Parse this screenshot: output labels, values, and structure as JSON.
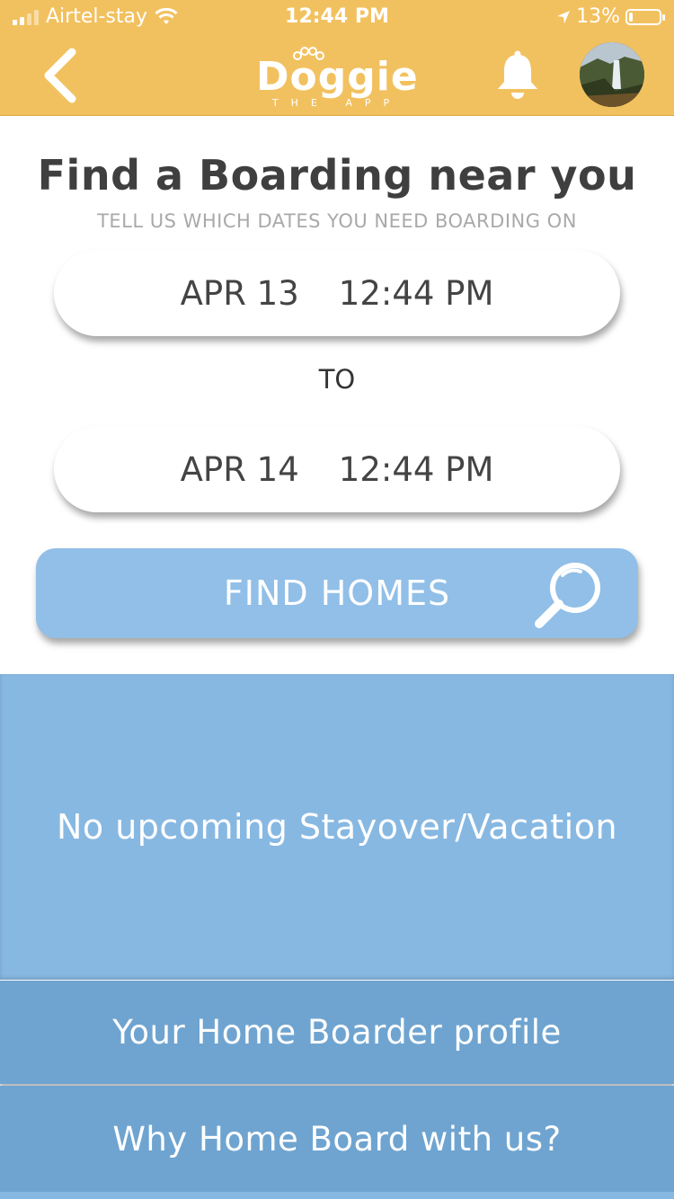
{
  "status_bar": {
    "carrier": "Airtel-stay",
    "time": "12:44 PM",
    "battery_percent_label": "13%",
    "battery_level": 0.13,
    "signal_bars": 2
  },
  "header": {
    "logo_text": "Doggie",
    "logo_subtext": "THE APP",
    "back_icon": "chevron-left-icon",
    "bell_icon": "bell-icon",
    "avatar": "profile-avatar"
  },
  "search": {
    "title": "Find a Boarding near you",
    "subtitle": "TELL US WHICH DATES YOU NEED BOARDING ON",
    "from": {
      "date": "APR 13",
      "time": "12:44 PM"
    },
    "to_label": "TO",
    "to": {
      "date": "APR 14",
      "time": "12:44 PM"
    },
    "find_button_label": "FIND HOMES",
    "find_icon": "search-icon"
  },
  "upcoming": {
    "empty_message": "No upcoming Stayover/Vacation"
  },
  "links": {
    "profile_label": "Your Home Boarder profile",
    "why_label": "Why Home Board with us?"
  },
  "colors": {
    "header_bg": "#f2c15f",
    "button_blue": "#91bfe8",
    "panel_blue": "#87b8e2",
    "row_blue": "#6fa4d0",
    "title_text": "#3f3f3f"
  }
}
